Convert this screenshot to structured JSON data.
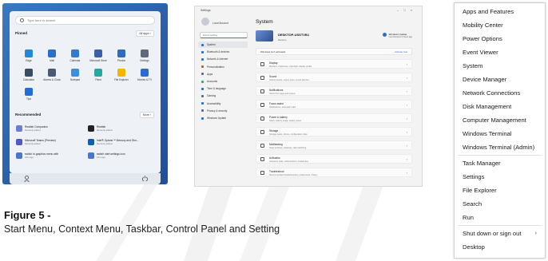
{
  "start_menu": {
    "search_placeholder": "Type here to search",
    "pinned_title": "Pinned",
    "all_apps_label": "All apps ›",
    "pinned_apps": [
      {
        "label": "Edge",
        "icon": "edge-icon",
        "color": "#1f8ad9"
      },
      {
        "label": "Mail",
        "icon": "mail-icon",
        "color": "#2a6fc9"
      },
      {
        "label": "Calendar",
        "icon": "calendar-icon",
        "color": "#2f7bd1"
      },
      {
        "label": "Microsoft Store",
        "icon": "store-icon",
        "color": "#3b5ea9"
      },
      {
        "label": "Photos",
        "icon": "photos-icon",
        "color": "#2d6cc0"
      },
      {
        "label": "Settings",
        "icon": "gear-icon",
        "color": "#5f6b7a"
      },
      {
        "label": "Calculator",
        "icon": "calculator-icon",
        "color": "#3a4c63"
      },
      {
        "label": "Alarms & Clock",
        "icon": "alarm-icon",
        "color": "#4a5a70"
      },
      {
        "label": "Notepad",
        "icon": "notepad-icon",
        "color": "#3e8ee0"
      },
      {
        "label": "Paint",
        "icon": "paint-icon",
        "color": "#2aa6a0"
      },
      {
        "label": "File Explorer",
        "icon": "folder-icon",
        "color": "#f4b400"
      },
      {
        "label": "Movies & TV",
        "icon": "movies-icon",
        "color": "#2c6bd0"
      },
      {
        "label": "Tips",
        "icon": "tips-icon",
        "color": "#1f6fd6"
      }
    ],
    "recommended_title": "Recommended",
    "more_label": "More ›",
    "recommended": [
      {
        "title": "Realtek Companion",
        "sub": "Recently added",
        "icon": "realtek-icon",
        "color": "#6c7cd8"
      },
      {
        "title": "Realtek",
        "sub": "Recently added",
        "icon": "realtek-logo-icon",
        "color": "#222222"
      },
      {
        "title": "Microsoft Teams (Preview)",
        "sub": "Recently added",
        "icon": "teams-icon",
        "color": "#5059c9"
      },
      {
        "title": "Intel® Optane™ Memory and Stor...",
        "sub": "Recently added",
        "icon": "intel-icon",
        "color": "#0a5fb3"
      },
      {
        "title": "switch to graphics menu with",
        "sub": "13m ago",
        "icon": "doc-icon",
        "color": "#4a78c8"
      },
      {
        "title": "switch start settings icon",
        "sub": "13m ago",
        "icon": "doc-icon",
        "color": "#4a78c8"
      }
    ]
  },
  "settings": {
    "window_title": "Settings",
    "user_label": "Local Account",
    "search_placeholder": "Find a setting",
    "nav": [
      {
        "label": "System",
        "icon": "system-icon",
        "color": "#2b6bd6"
      },
      {
        "label": "Bluetooth & devices",
        "icon": "bluetooth-icon",
        "color": "#2b6bd6"
      },
      {
        "label": "Network & internet",
        "icon": "network-icon",
        "color": "#2b6bd6"
      },
      {
        "label": "Personalization",
        "icon": "brush-icon",
        "color": "#9a6b3c"
      },
      {
        "label": "Apps",
        "icon": "apps-icon",
        "color": "#5a6a80"
      },
      {
        "label": "Accounts",
        "icon": "accounts-icon",
        "color": "#3aa36e"
      },
      {
        "label": "Time & language",
        "icon": "clock-icon",
        "color": "#2b6bd6"
      },
      {
        "label": "Gaming",
        "icon": "gaming-icon",
        "color": "#5a6a80"
      },
      {
        "label": "Accessibility",
        "icon": "accessibility-icon",
        "color": "#2b6bd6"
      },
      {
        "label": "Privacy & security",
        "icon": "shield-icon",
        "color": "#5a6a80"
      },
      {
        "label": "Windows Update",
        "icon": "update-icon",
        "color": "#2b6bd6"
      }
    ],
    "page_title": "System",
    "device_name": "DESKTOP-USSTVB1",
    "device_sub": "Rename",
    "windows_update": {
      "title": "Windows Update",
      "sub": "Last checked: 4 hours ago"
    },
    "notice": {
      "text": "Windows isn't activated.",
      "action": "Activate now"
    },
    "rows": [
      {
        "title": "Display",
        "desc": "Monitors, brightness, night light, display profile",
        "icon": "display-icon"
      },
      {
        "title": "Sound",
        "desc": "Volume levels, output, input, sound devices",
        "icon": "sound-icon"
      },
      {
        "title": "Notifications",
        "desc": "Alerts from apps and system",
        "icon": "bell-icon"
      },
      {
        "title": "Focus assist",
        "desc": "Notifications, automatic rules",
        "icon": "moon-icon"
      },
      {
        "title": "Power & battery",
        "desc": "Sleep, battery usage, battery saver",
        "icon": "power-icon"
      },
      {
        "title": "Storage",
        "desc": "Storage space, drives, configuration rules",
        "icon": "storage-icon"
      },
      {
        "title": "Multitasking",
        "desc": "Snap windows, desktops, task switching",
        "icon": "multitask-icon"
      },
      {
        "title": "Activation",
        "desc": "Activation state, subscriptions, product key",
        "icon": "activation-icon"
      },
      {
        "title": "Troubleshoot",
        "desc": "Recommended troubleshooters, preferences, history",
        "icon": "wrench-icon"
      }
    ]
  },
  "context_menu": {
    "items": [
      "Apps and Features",
      "Mobility Center",
      "Power Options",
      "Event Viewer",
      "System",
      "Device Manager",
      "Network Connections",
      "Disk Management",
      "Computer Management",
      "Windows Terminal",
      "Windows Terminal (Admin)",
      "Task Manager",
      "Settings",
      "File Explorer",
      "Search",
      "Run",
      "Shut down or sign out",
      "Desktop"
    ],
    "submenu_arrow": "›"
  },
  "figure": {
    "label": "Figure 5 -",
    "caption": "Start Menu, Context Menu, Taskbar, Control Panel and Setting"
  }
}
